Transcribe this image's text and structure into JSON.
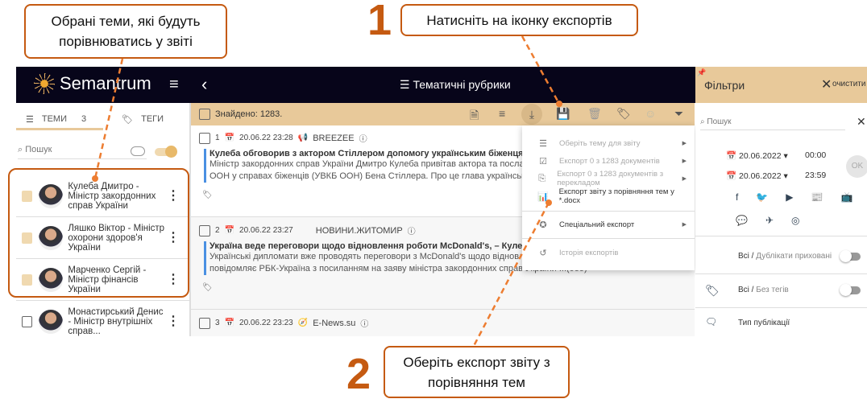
{
  "app": {
    "logo": "Semantrum",
    "page_title": "Тематичні рубрики"
  },
  "sidebar": {
    "tab_topics": "ТЕМИ",
    "topics_count": "3",
    "tab_tags": "ТЕГИ",
    "search_placeholder": "Пошук",
    "items": [
      {
        "name": "Кулеба Дмитро - Міністр закордонних справ України",
        "checked": true
      },
      {
        "name": "Ляшко Віктор - Міністр охорони здоров'я України",
        "checked": true
      },
      {
        "name": "Марченко Сергій - Міністр фінансів України",
        "checked": true
      },
      {
        "name": "Монастирський Денис - Міністр внутрішніх справ...",
        "checked": false
      }
    ]
  },
  "main": {
    "found": "Знайдено: 1283.",
    "articles": [
      {
        "n": "1",
        "date": "20.06.22 23:28",
        "source": "BREEZEE",
        "title": "Кулеба обговорив з актором Стіллером допомогу українським біженцям",
        "body1": "Міністр закордонних справ України Дмитро Кулеба привітав актора та посла доброї волі Управління Верховного комісара",
        "body2": "ООН у справах біженців (УВКБ ООН) Бена Стіллера. Про це глава української дипломатії"
      },
      {
        "n": "2",
        "date": "20.06.22 23:27",
        "source": "НОВИНИ.ЖИТОМИР",
        "title": "Україна веде переговори щодо відновлення роботи McDonald's, – Кулеба",
        "body1": "Українські дипломати вже проводять переговори з McDonald's щодо відновлення роботи мережі в Україні, про це",
        "body2": "повідомляє РБК-Україна з посиланням на заяву міністра закордонних справ України ...(955)"
      },
      {
        "n": "3",
        "date": "20.06.22 23:23",
        "source": "E-News.su"
      }
    ]
  },
  "export_menu": {
    "items": [
      {
        "label": "Оберіть тему для звіту",
        "enabled": false
      },
      {
        "label": "Експорт 0 з 1283 документів",
        "enabled": false
      },
      {
        "label": "Експорт 0 з 1283 документів з перекладом",
        "enabled": false
      },
      {
        "label": "Експорт звіту з порівняння тем у *.docx",
        "enabled": true
      },
      {
        "label": "Спеціальний експорт",
        "enabled": true
      },
      {
        "label": "Історія експортів",
        "enabled": false
      }
    ]
  },
  "filters": {
    "title": "Фільтри",
    "clear": "очистити",
    "search_placeholder": "Пошук",
    "date_from": "20.06.2022",
    "time_from": "00:00",
    "date_to": "20.06.2022",
    "time_to": "23:59",
    "ok": "OK",
    "dup_all": "Всі",
    "dup_label": "Дублікати приховані",
    "tags_all": "Всі",
    "tags_label": "Без тегів",
    "pub_type": "Тип публікації"
  },
  "callouts": {
    "c1": "Обрані теми, які будуть порівнюватись у звіті",
    "n1": "1",
    "c2": "Натисніть на іконку експортів",
    "n2": "2",
    "c3": "Оберіть експорт звіту з порівняння тем"
  },
  "colors": {
    "accent": "#c55a11",
    "header": "#07051a",
    "beige": "#e8c99a"
  }
}
